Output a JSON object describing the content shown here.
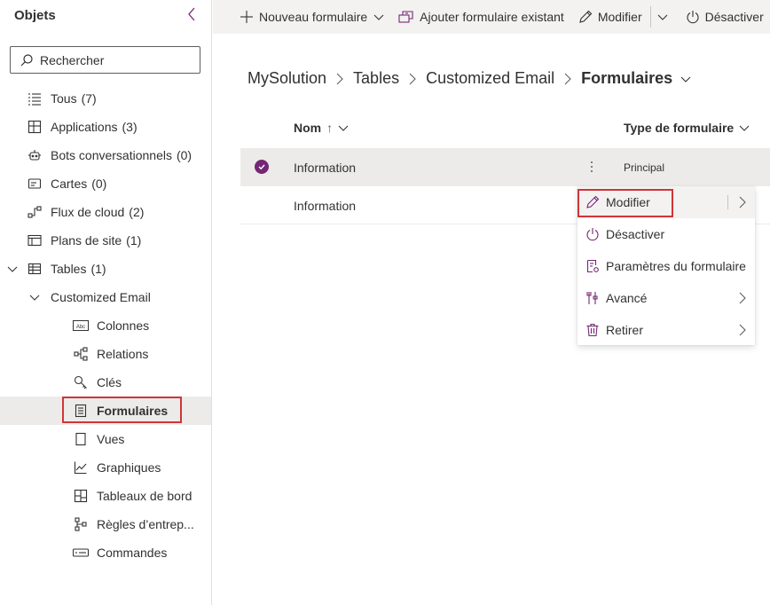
{
  "sidebar": {
    "title": "Objets",
    "search_placeholder": "Rechercher",
    "items": [
      {
        "label": "Tous",
        "count": "(7)",
        "icon": "list-icon"
      },
      {
        "label": "Applications",
        "count": "(3)",
        "icon": "apps-icon"
      },
      {
        "label": "Bots conversationnels",
        "count": "(0)",
        "icon": "bot-icon"
      },
      {
        "label": "Cartes",
        "count": "(0)",
        "icon": "card-icon"
      },
      {
        "label": "Flux de cloud",
        "count": "(2)",
        "icon": "flow-icon"
      },
      {
        "label": "Plans de site",
        "count": "(1)",
        "icon": "sitemap-icon"
      },
      {
        "label": "Tables",
        "count": "(1)",
        "icon": "table-icon"
      },
      {
        "label": "Customized Email",
        "count": "",
        "icon": ""
      },
      {
        "label": "Colonnes",
        "count": "",
        "icon": "columns-icon"
      },
      {
        "label": "Relations",
        "count": "",
        "icon": "relations-icon"
      },
      {
        "label": "Clés",
        "count": "",
        "icon": "key-icon"
      },
      {
        "label": "Formulaires",
        "count": "",
        "icon": "form-icon"
      },
      {
        "label": "Vues",
        "count": "",
        "icon": "view-icon"
      },
      {
        "label": "Graphiques",
        "count": "",
        "icon": "chart-icon"
      },
      {
        "label": "Tableaux de bord",
        "count": "",
        "icon": "dashboard-icon"
      },
      {
        "label": "Règles d’entrep...",
        "count": "",
        "icon": "rules-icon"
      },
      {
        "label": "Commandes",
        "count": "",
        "icon": "command-icon"
      }
    ]
  },
  "toolbar": {
    "new_form": "Nouveau formulaire",
    "add_existing": "Ajouter formulaire existant",
    "edit": "Modifier",
    "deactivate": "Désactiver"
  },
  "breadcrumb": {
    "items": [
      "MySolution",
      "Tables",
      "Customized Email"
    ],
    "current": "Formulaires"
  },
  "grid": {
    "col_name": "Nom",
    "col_name_sort": "↑",
    "col_type": "Type de formulaire",
    "rows": [
      {
        "name": "Information",
        "type": "Principal",
        "selected": true
      },
      {
        "name": "Information",
        "type": "",
        "selected": false
      }
    ]
  },
  "context_menu": {
    "items": [
      {
        "label": "Modifier",
        "icon": "pencil-icon",
        "submenu": true
      },
      {
        "label": "Désactiver",
        "icon": "power-icon",
        "submenu": false
      },
      {
        "label": "Paramètres du formulaire",
        "icon": "form-settings-icon",
        "submenu": false
      },
      {
        "label": "Avancé",
        "icon": "advanced-icon",
        "submenu": true
      },
      {
        "label": "Retirer",
        "icon": "trash-icon",
        "submenu": true
      }
    ]
  },
  "colors": {
    "accent": "#742774",
    "highlight_border": "#d13438",
    "toolbar_bg": "#f3f2f1",
    "selected_bg": "#edebe9"
  }
}
